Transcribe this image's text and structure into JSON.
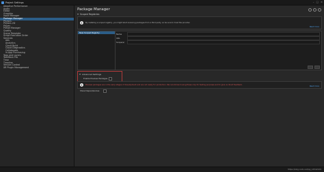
{
  "window": {
    "title": "Project Settings"
  },
  "sidebar": {
    "items": [
      {
        "label": "Adaptive Performance",
        "sub": false
      },
      {
        "label": "Audio",
        "sub": false
      },
      {
        "label": "Editor",
        "sub": false
      },
      {
        "label": "Graphics",
        "sub": false
      },
      {
        "label": "Input Manager",
        "sub": false
      },
      {
        "label": "Package Manager",
        "sub": false,
        "active": true
      },
      {
        "label": "Physics",
        "sub": false
      },
      {
        "label": "Physics 2D",
        "sub": false
      },
      {
        "label": "Player",
        "sub": false
      },
      {
        "label": "Preset Manager",
        "sub": false
      },
      {
        "label": "Quality",
        "sub": false
      },
      {
        "label": "Scene Template",
        "sub": false
      },
      {
        "label": "Script Execution Order",
        "sub": false
      },
      {
        "label": "Services",
        "sub": false
      },
      {
        "label": "Ads",
        "sub": true
      },
      {
        "label": "Analytics",
        "sub": true
      },
      {
        "label": "Cloud Build",
        "sub": true
      },
      {
        "label": "Cloud Diagnostics",
        "sub": true
      },
      {
        "label": "Collaborate",
        "sub": true
      },
      {
        "label": "In-App Purchasing",
        "sub": true
      },
      {
        "label": "Tags and Layers",
        "sub": false
      },
      {
        "label": "TextMesh Pro",
        "sub": false
      },
      {
        "label": "Time",
        "sub": false
      },
      {
        "label": "Timeline",
        "sub": false
      },
      {
        "label": "Version Control",
        "sub": false
      },
      {
        "label": "XR Plugin Management",
        "sub": false
      }
    ]
  },
  "main": {
    "title": "Package Manager",
    "scoped_registries": {
      "section_label": "Scoped Registries",
      "info_text": "By installing a scoped registry, you might start receiving packages from a third party, so be sure to trust the provider.",
      "info_link": "Read more",
      "list_item": "New Scoped Registry",
      "fields": [
        "Name",
        "URL",
        "Scope(s)"
      ]
    },
    "advanced": {
      "section_label": "Advanced Settings",
      "checkbox_label": "Enable Preview Packages",
      "warning_text": "Preview packages are in the early stages of development and are not ready for production. We recommend using these only for testing purposes and to give us direct feedback.",
      "warning_link": "Read more"
    },
    "show_dependencies": "Show Dependencies"
  },
  "status": {
    "watermark": "https://blog.csdn.net/qq_14542129"
  }
}
